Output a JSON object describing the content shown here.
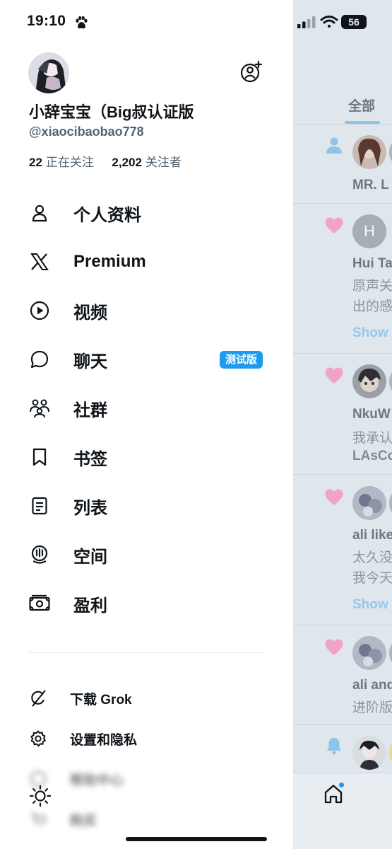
{
  "status_bar": {
    "time": "19:10",
    "battery": "56"
  },
  "profile": {
    "name": "小辞宝宝（Big叔认证版",
    "handle": "@xiaocibaobao778",
    "following_count": "22",
    "following_label": "正在关注",
    "followers_count": "2,202",
    "followers_label": "关注者"
  },
  "menu": {
    "items": [
      {
        "label": "个人资料",
        "icon": "person-icon"
      },
      {
        "label": "Premium",
        "icon": "x-logo-icon"
      },
      {
        "label": "视频",
        "icon": "play-circle-icon"
      },
      {
        "label": "聊天",
        "icon": "chat-bubble-icon",
        "badge": "测试版"
      },
      {
        "label": "社群",
        "icon": "people-icon"
      },
      {
        "label": "书签",
        "icon": "bookmark-icon"
      },
      {
        "label": "列表",
        "icon": "list-icon"
      },
      {
        "label": "空间",
        "icon": "spaces-icon"
      },
      {
        "label": "盈利",
        "icon": "money-icon"
      }
    ]
  },
  "secondary": {
    "items": [
      {
        "label": "下载 Grok",
        "icon": "grok-icon"
      },
      {
        "label": "设置和隐私",
        "icon": "gear-icon"
      },
      {
        "label": "帮助中心",
        "icon": "help-icon"
      },
      {
        "label": "购买",
        "icon": "cart-icon"
      }
    ]
  },
  "timeline": {
    "tab_label": "全部",
    "notifications": [
      {
        "type": "follow",
        "name": "MR. L"
      },
      {
        "type": "like",
        "name": "Hui Ta",
        "avatar_letter": "H",
        "lines": [
          "原声关",
          "出的感"
        ],
        "show": "Show"
      },
      {
        "type": "like",
        "name": "NkuW",
        "lines": [
          "我承认"
        ],
        "bold": "LAsCo"
      },
      {
        "type": "like",
        "name": "ali like",
        "lines": [
          "太久没",
          "我今天"
        ],
        "show": "Show"
      },
      {
        "type": "like",
        "name": "ali and",
        "lines": [
          "进阶版"
        ]
      },
      {
        "type": "bell"
      }
    ]
  },
  "colors": {
    "accent": "#1d9bf0",
    "text_primary": "#0f1419",
    "text_secondary": "#536471",
    "like_pink": "#f0a3c7",
    "follow_blue": "#8ec3ea"
  }
}
